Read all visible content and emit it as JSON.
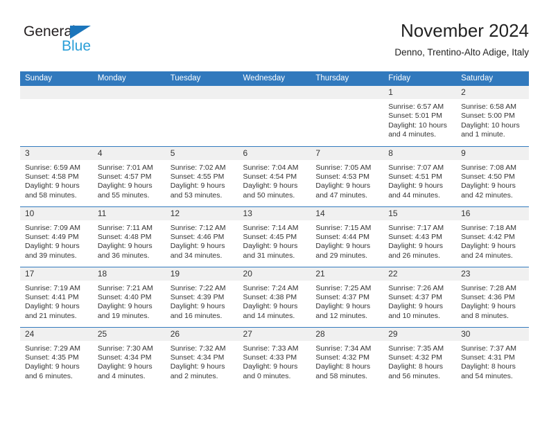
{
  "brand": {
    "name_top": "General",
    "name_bottom": "Blue",
    "triangle_color": "#1b75bb",
    "blue_color": "#2a9fd8",
    "top_color": "#231f20"
  },
  "header": {
    "title": "November 2024",
    "subtitle": "Denno, Trentino-Alto Adige, Italy"
  },
  "theme": {
    "header_blue": "#3179bd",
    "daynum_band": "#f0f0f0",
    "text": "#333333",
    "cell_bg": "#ffffff"
  },
  "weekdays": [
    "Sunday",
    "Monday",
    "Tuesday",
    "Wednesday",
    "Thursday",
    "Friday",
    "Saturday"
  ],
  "weeks": [
    [
      {
        "day": "",
        "empty": true
      },
      {
        "day": "",
        "empty": true
      },
      {
        "day": "",
        "empty": true
      },
      {
        "day": "",
        "empty": true
      },
      {
        "day": "",
        "empty": true
      },
      {
        "day": "1",
        "sunrise": "Sunrise: 6:57 AM",
        "sunset": "Sunset: 5:01 PM",
        "daylight": "Daylight: 10 hours and 4 minutes."
      },
      {
        "day": "2",
        "sunrise": "Sunrise: 6:58 AM",
        "sunset": "Sunset: 5:00 PM",
        "daylight": "Daylight: 10 hours and 1 minute."
      }
    ],
    [
      {
        "day": "3",
        "sunrise": "Sunrise: 6:59 AM",
        "sunset": "Sunset: 4:58 PM",
        "daylight": "Daylight: 9 hours and 58 minutes."
      },
      {
        "day": "4",
        "sunrise": "Sunrise: 7:01 AM",
        "sunset": "Sunset: 4:57 PM",
        "daylight": "Daylight: 9 hours and 55 minutes."
      },
      {
        "day": "5",
        "sunrise": "Sunrise: 7:02 AM",
        "sunset": "Sunset: 4:55 PM",
        "daylight": "Daylight: 9 hours and 53 minutes."
      },
      {
        "day": "6",
        "sunrise": "Sunrise: 7:04 AM",
        "sunset": "Sunset: 4:54 PM",
        "daylight": "Daylight: 9 hours and 50 minutes."
      },
      {
        "day": "7",
        "sunrise": "Sunrise: 7:05 AM",
        "sunset": "Sunset: 4:53 PM",
        "daylight": "Daylight: 9 hours and 47 minutes."
      },
      {
        "day": "8",
        "sunrise": "Sunrise: 7:07 AM",
        "sunset": "Sunset: 4:51 PM",
        "daylight": "Daylight: 9 hours and 44 minutes."
      },
      {
        "day": "9",
        "sunrise": "Sunrise: 7:08 AM",
        "sunset": "Sunset: 4:50 PM",
        "daylight": "Daylight: 9 hours and 42 minutes."
      }
    ],
    [
      {
        "day": "10",
        "sunrise": "Sunrise: 7:09 AM",
        "sunset": "Sunset: 4:49 PM",
        "daylight": "Daylight: 9 hours and 39 minutes."
      },
      {
        "day": "11",
        "sunrise": "Sunrise: 7:11 AM",
        "sunset": "Sunset: 4:48 PM",
        "daylight": "Daylight: 9 hours and 36 minutes."
      },
      {
        "day": "12",
        "sunrise": "Sunrise: 7:12 AM",
        "sunset": "Sunset: 4:46 PM",
        "daylight": "Daylight: 9 hours and 34 minutes."
      },
      {
        "day": "13",
        "sunrise": "Sunrise: 7:14 AM",
        "sunset": "Sunset: 4:45 PM",
        "daylight": "Daylight: 9 hours and 31 minutes."
      },
      {
        "day": "14",
        "sunrise": "Sunrise: 7:15 AM",
        "sunset": "Sunset: 4:44 PM",
        "daylight": "Daylight: 9 hours and 29 minutes."
      },
      {
        "day": "15",
        "sunrise": "Sunrise: 7:17 AM",
        "sunset": "Sunset: 4:43 PM",
        "daylight": "Daylight: 9 hours and 26 minutes."
      },
      {
        "day": "16",
        "sunrise": "Sunrise: 7:18 AM",
        "sunset": "Sunset: 4:42 PM",
        "daylight": "Daylight: 9 hours and 24 minutes."
      }
    ],
    [
      {
        "day": "17",
        "sunrise": "Sunrise: 7:19 AM",
        "sunset": "Sunset: 4:41 PM",
        "daylight": "Daylight: 9 hours and 21 minutes."
      },
      {
        "day": "18",
        "sunrise": "Sunrise: 7:21 AM",
        "sunset": "Sunset: 4:40 PM",
        "daylight": "Daylight: 9 hours and 19 minutes."
      },
      {
        "day": "19",
        "sunrise": "Sunrise: 7:22 AM",
        "sunset": "Sunset: 4:39 PM",
        "daylight": "Daylight: 9 hours and 16 minutes."
      },
      {
        "day": "20",
        "sunrise": "Sunrise: 7:24 AM",
        "sunset": "Sunset: 4:38 PM",
        "daylight": "Daylight: 9 hours and 14 minutes."
      },
      {
        "day": "21",
        "sunrise": "Sunrise: 7:25 AM",
        "sunset": "Sunset: 4:37 PM",
        "daylight": "Daylight: 9 hours and 12 minutes."
      },
      {
        "day": "22",
        "sunrise": "Sunrise: 7:26 AM",
        "sunset": "Sunset: 4:37 PM",
        "daylight": "Daylight: 9 hours and 10 minutes."
      },
      {
        "day": "23",
        "sunrise": "Sunrise: 7:28 AM",
        "sunset": "Sunset: 4:36 PM",
        "daylight": "Daylight: 9 hours and 8 minutes."
      }
    ],
    [
      {
        "day": "24",
        "sunrise": "Sunrise: 7:29 AM",
        "sunset": "Sunset: 4:35 PM",
        "daylight": "Daylight: 9 hours and 6 minutes."
      },
      {
        "day": "25",
        "sunrise": "Sunrise: 7:30 AM",
        "sunset": "Sunset: 4:34 PM",
        "daylight": "Daylight: 9 hours and 4 minutes."
      },
      {
        "day": "26",
        "sunrise": "Sunrise: 7:32 AM",
        "sunset": "Sunset: 4:34 PM",
        "daylight": "Daylight: 9 hours and 2 minutes."
      },
      {
        "day": "27",
        "sunrise": "Sunrise: 7:33 AM",
        "sunset": "Sunset: 4:33 PM",
        "daylight": "Daylight: 9 hours and 0 minutes."
      },
      {
        "day": "28",
        "sunrise": "Sunrise: 7:34 AM",
        "sunset": "Sunset: 4:32 PM",
        "daylight": "Daylight: 8 hours and 58 minutes."
      },
      {
        "day": "29",
        "sunrise": "Sunrise: 7:35 AM",
        "sunset": "Sunset: 4:32 PM",
        "daylight": "Daylight: 8 hours and 56 minutes."
      },
      {
        "day": "30",
        "sunrise": "Sunrise: 7:37 AM",
        "sunset": "Sunset: 4:31 PM",
        "daylight": "Daylight: 8 hours and 54 minutes."
      }
    ]
  ]
}
